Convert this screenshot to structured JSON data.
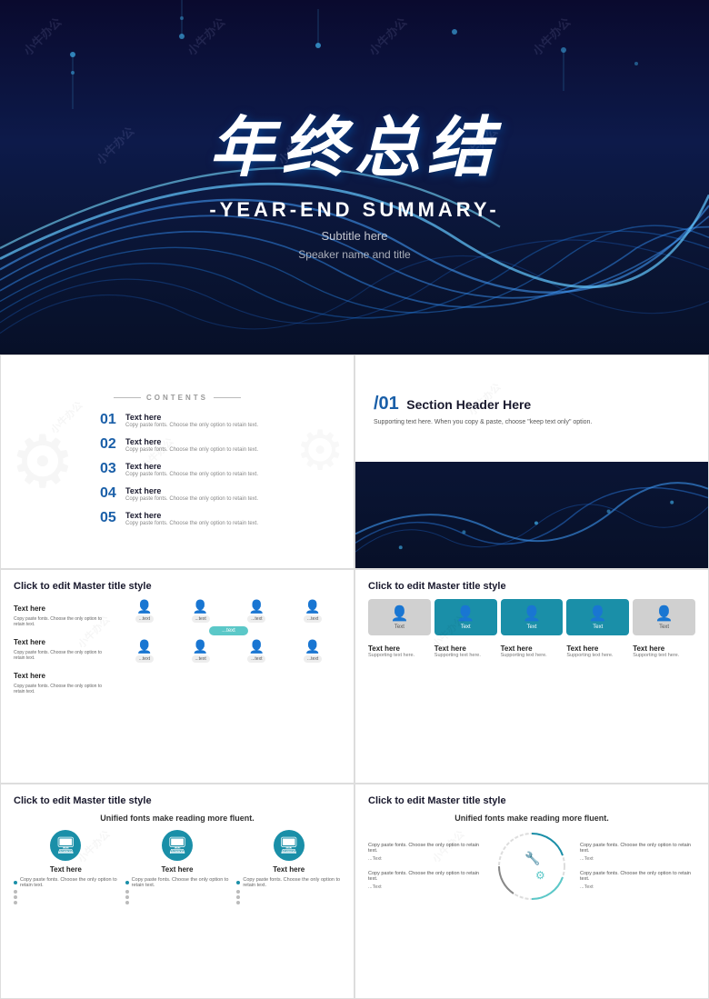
{
  "hero": {
    "chinese_title": "年终总结",
    "english_title": "-YEAR-END SUMMARY-",
    "subtitle": "Subtitle here",
    "speaker": "Speaker name and title"
  },
  "slide2": {
    "label": "CONTENTS",
    "items": [
      {
        "num": "01",
        "title": "Text here",
        "sub": "Copy paste fonts. Choose the only option to retain text."
      },
      {
        "num": "02",
        "title": "Text here",
        "sub": "Copy paste fonts. Choose the only option to retain text."
      },
      {
        "num": "03",
        "title": "Text here",
        "sub": "Copy paste fonts. Choose the only option to retain text."
      },
      {
        "num": "04",
        "title": "Text here",
        "sub": "Copy paste fonts. Choose the only option to retain text."
      },
      {
        "num": "05",
        "title": "Text here",
        "sub": "Copy paste fonts. Choose the only option to retain text."
      }
    ]
  },
  "slide3": {
    "section_num": "/01",
    "header_title": "Section Header Here",
    "support_text": "Supporting text here.\nWhen you copy & paste, choose \"keep text only\" option."
  },
  "slide4": {
    "title": "Click to edit Master title style",
    "text_blocks": [
      {
        "title": "Text here",
        "body": "Copy paste fonts. Choose the only option to retain text."
      },
      {
        "title": "Text here",
        "body": "Copy paste fonts. Choose the only option to retain text."
      },
      {
        "title": "Text here",
        "body": "Copy paste fonts. Choose the only option to retain text."
      }
    ],
    "flow_label": "...text",
    "flow_items": [
      "...text",
      "...text",
      "...text",
      "...text",
      "...text",
      "...text",
      "...text",
      "...text"
    ]
  },
  "slide5": {
    "title": "Click to edit Master title style",
    "tabs": [
      {
        "label": "Text",
        "active": false
      },
      {
        "label": "Text",
        "active": true
      },
      {
        "label": "Text",
        "active": true
      },
      {
        "label": "Text",
        "active": true
      },
      {
        "label": "Text",
        "active": false
      }
    ],
    "support_items": [
      {
        "title": "Text here",
        "sub": "Supporting text here."
      },
      {
        "title": "Text here",
        "sub": "Supporting text here."
      },
      {
        "title": "Text here",
        "sub": "Supporting text here."
      },
      {
        "title": "Text here",
        "sub": "Supporting text here."
      },
      {
        "title": "Text here",
        "sub": "Supporting text here."
      }
    ]
  },
  "slide6": {
    "title": "Click to edit Master title style",
    "unified_label": "Unified fonts make reading more fluent.",
    "icon_items": [
      {
        "title": "Text here",
        "bullets": [
          "Copy paste fonts. Choose the only option to retain text.",
          "",
          "",
          ""
        ]
      },
      {
        "title": "Text here",
        "bullets": [
          "Copy paste fonts. Choose the only option to retain text.",
          "",
          "",
          ""
        ]
      },
      {
        "title": "Text here",
        "bullets": [
          "Copy paste fonts. Choose the only option to retain text.",
          "",
          "",
          ""
        ]
      }
    ]
  },
  "slide7": {
    "title": "Click to edit Master title style",
    "unified_label": "Unified fonts make reading more fluent.",
    "left_blocks": [
      {
        "title": "Copy paste fonts. Choose the only option to retain text.",
        "label": "...Text"
      },
      {
        "title": "Copy paste fonts. Choose the only option to retain text.",
        "label": "...Text"
      }
    ],
    "right_blocks": [
      {
        "title": "Copy paste fonts. Choose the only option to retain text.",
        "label": "...Text"
      },
      {
        "title": "Copy paste fonts. Choose the only option to retain text.",
        "label": "...Text"
      }
    ]
  },
  "colors": {
    "teal": "#1a8fa8",
    "dark_blue": "#0d1a4a",
    "navy": "#071028",
    "light_teal": "#5bc8c8"
  }
}
